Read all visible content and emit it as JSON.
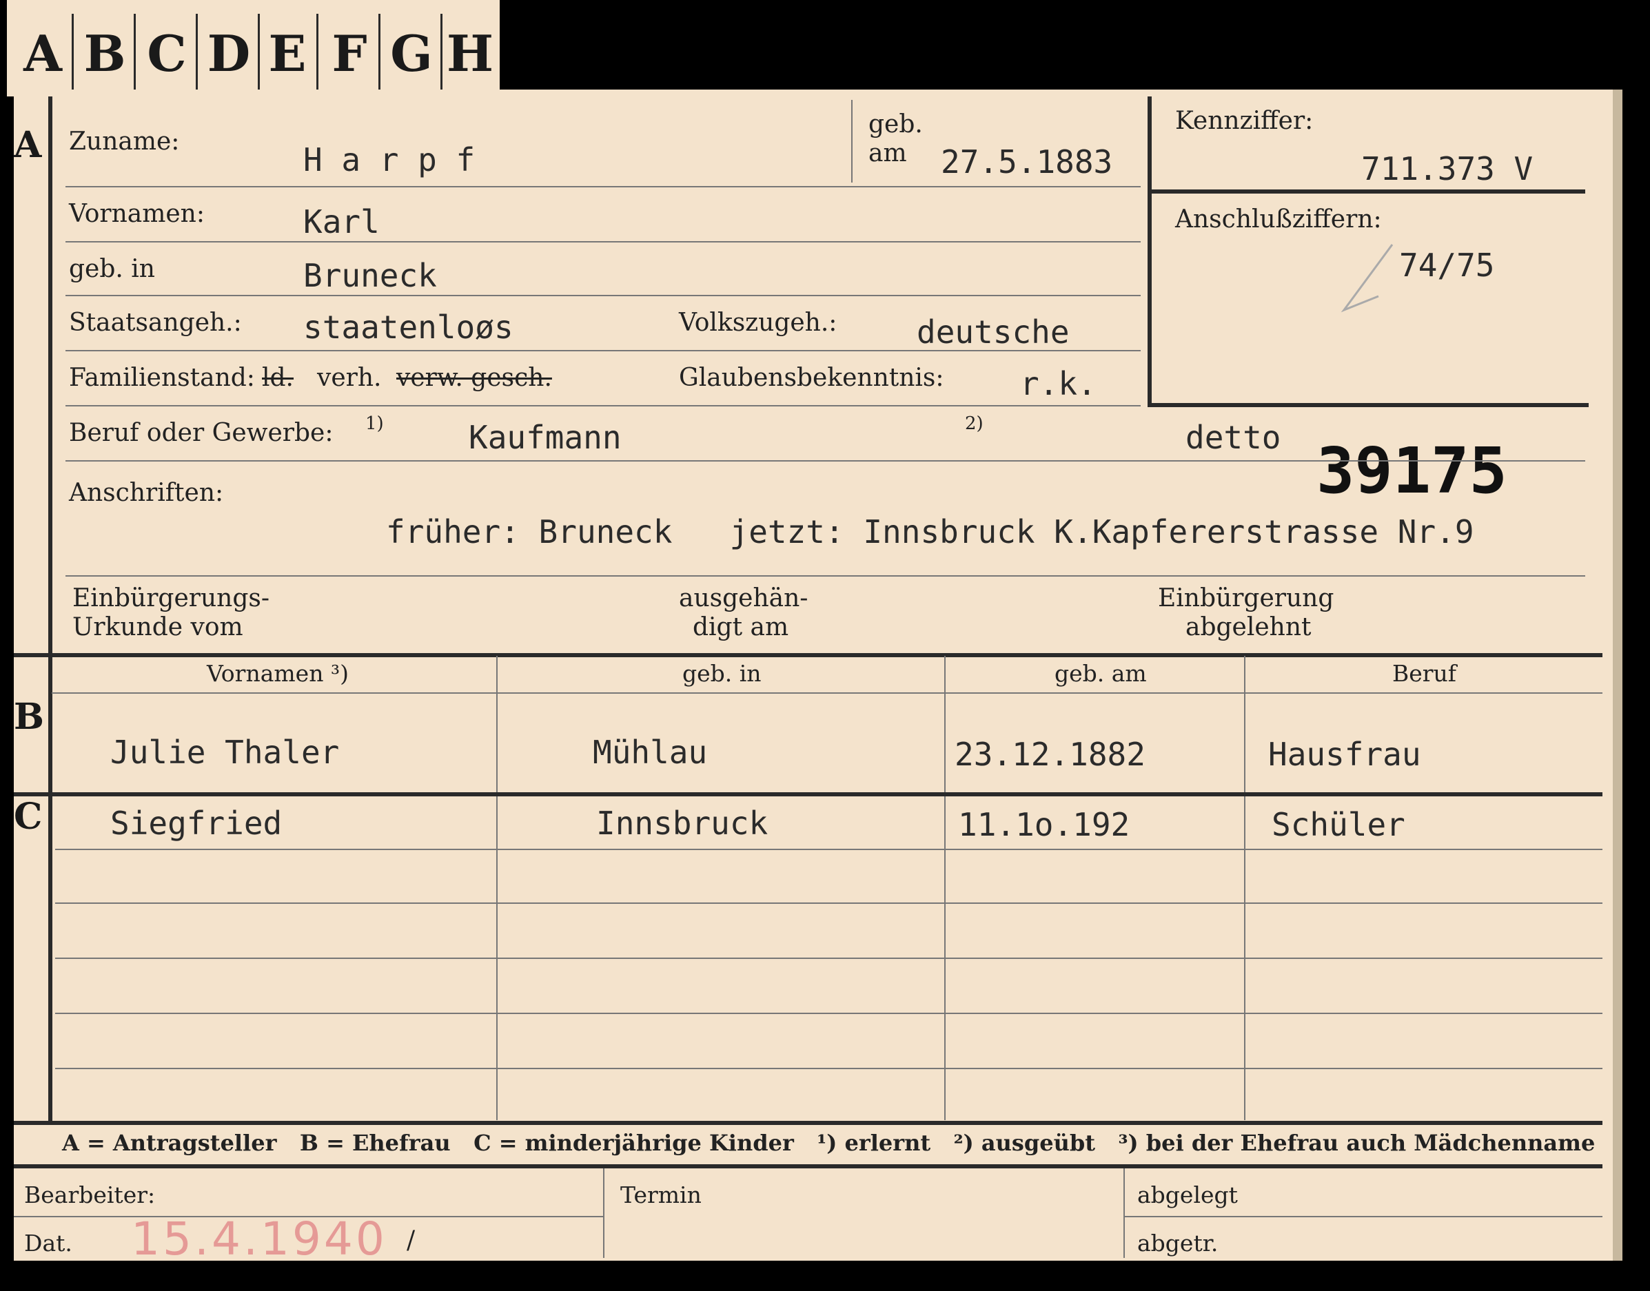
{
  "tabs": [
    "A",
    "B",
    "C",
    "D",
    "E",
    "F",
    "G",
    "H"
  ],
  "section_a": {
    "letter": "A",
    "surname_label": "Zuname:",
    "surname": "H a r p f",
    "born_label_1": "geb.",
    "born_label_2": "am",
    "born_date": "27.5.1883",
    "kennziffer_label": "Kennziffer:",
    "kennziffer": "711.373 V",
    "anschluss_label": "Anschlußziffern:",
    "anschluss": "74/75",
    "firstnames_label": "Vornamen:",
    "firstnames": "Karl",
    "birthplace_label": "geb. in",
    "birthplace": "Bruneck",
    "citizenship_label": "Staatsangeh.:",
    "citizenship": "staatenloøs",
    "ethnicity_label": "Volkszugeh.:",
    "ethnicity": "deutsche",
    "marital_label": "Familienstand:",
    "marital_struck_1": "ld.",
    "marital_value": "verh.",
    "marital_struck_2": "verw. gesch.",
    "religion_label": "Glaubensbekenntnis:",
    "religion": "r.k.",
    "profession_label": "Beruf oder Gewerbe:",
    "profession_note_1": "1)",
    "profession_1": "Kaufmann",
    "profession_note_2": "2)",
    "profession_2": "detto",
    "stamp_number": "39175",
    "address_label": "Anschriften:",
    "address": "früher: Bruneck   jetzt: Innsbruck K.Kapfererstrasse Nr.9",
    "naturalization_doc_1": "Einbürgerungs-",
    "naturalization_doc_2": "Urkunde vom",
    "handed_over_1": "ausgehän-",
    "handed_over_2": "digt am",
    "naturalization_denied_1": "Einbürgerung",
    "naturalization_denied_2": "abgelehnt"
  },
  "section_b": {
    "letter": "B",
    "headers": [
      "Vornamen ³)",
      "geb. in",
      "geb. am",
      "Beruf"
    ],
    "row": [
      "Julie Thaler",
      "Mühlau",
      "23.12.1882",
      "Hausfrau"
    ]
  },
  "section_c": {
    "letter": "C",
    "row": [
      "Siegfried",
      "Innsbruck",
      "11.1o.192",
      "Schüler"
    ]
  },
  "legend": "A = Antragsteller   B = Ehefrau   C = minderjährige Kinder   ¹) erlernt   ²) ausgeübt   ³) bei der Ehefrau auch Mädchenname",
  "footer": {
    "bearbeiter_label": "Bearbeiter:",
    "dat_label": "Dat.",
    "dat_value": "15.4.1940",
    "slash": "/",
    "termin_label": "Termin",
    "abgelegt_label": "abgelegt",
    "abgetr_label": "abgetr."
  }
}
